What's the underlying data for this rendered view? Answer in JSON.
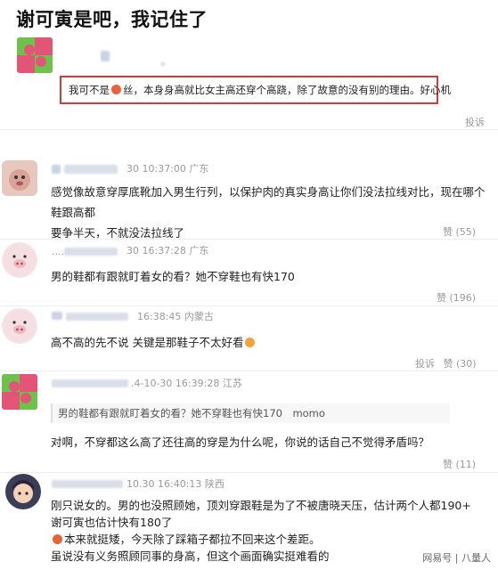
{
  "page_title": "谢可寅是吧，我记住了",
  "highlighted_comment": {
    "prefix": "我可不是",
    "suffix": "丝，本身身高就比女主高还穿个高跷，除了故意的没有别的理由。好心机"
  },
  "report_label": "投诉",
  "comments": [
    {
      "meta": "30 10:37:00 广东",
      "text_line1": "感觉像故意穿厚底靴加入男生行列，以保护肉的真实身高让你们没法拉线对比，现在哪个鞋跟高都",
      "text_line2": "要争半天，不就没法拉线了",
      "likes": "赞 (55)"
    },
    {
      "meta": "30 16:37:28 广东",
      "text": "男的鞋都有跟就盯着女的看？她不穿鞋也有快170",
      "likes": "赞 (196)"
    },
    {
      "meta": "16:38:45 内蒙古",
      "text": "高不高的先不说 关键是那鞋子不太好看",
      "report": "投诉",
      "likes": "赞 (30)"
    },
    {
      "meta": ".4-10-30 16:39:28 江苏",
      "quote": "男的鞋都有跟就盯着女的看？她不穿鞋也有快170　momo",
      "text": "对啊，不穿都这么高了还往高的穿是为什么呢，你说的话自己不觉得矛盾吗？",
      "likes": "赞 (11)"
    },
    {
      "meta": "10.30 16:40:13 陕西",
      "line1": "刚只说女的。男的也没照顾她，顶刘穿跟鞋是为了不被唐晓天压，估计两个人都190+",
      "line2": "谢可寅也估计快有180了",
      "line3": "本来就挺矮，今天除了踩箱子都拉不回来这个差距。",
      "line4": "虽说没有义务照顾同事的身高，但这个画面确实挺难看的"
    }
  ],
  "watermark": "网易号 | 八量人",
  "colors": {
    "red_border": "#d43b36",
    "meta_gray": "#9a9a9a"
  }
}
